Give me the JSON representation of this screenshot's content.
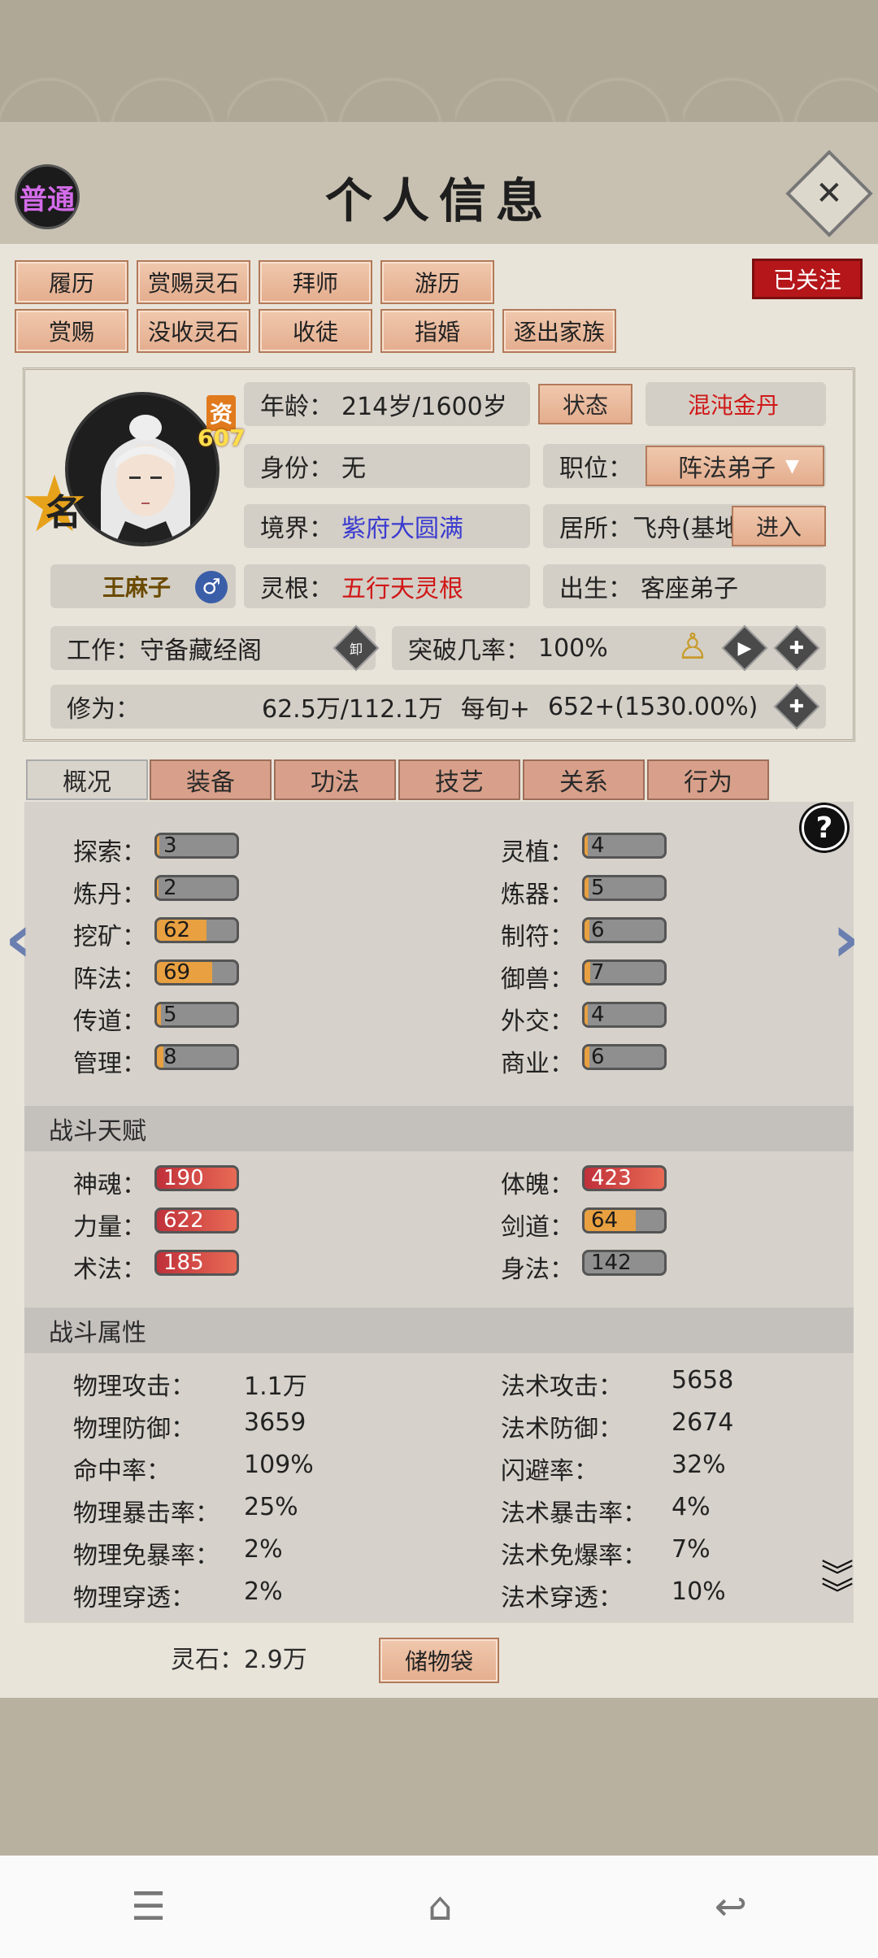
{
  "header": {
    "title": "个人信息",
    "tier": "普通",
    "follow": "已关注"
  },
  "actions": {
    "row1": [
      "履历",
      "赏赐灵石",
      "拜师",
      "游历"
    ],
    "row2": [
      "赏赐",
      "没收灵石",
      "收徒",
      "指婚",
      "逐出家族"
    ]
  },
  "character": {
    "name": "王麻子",
    "zi_label": "资",
    "zi_value": "607",
    "star_label": "名",
    "age_label": "年龄：",
    "age_value": "214岁/1600岁",
    "status_btn": "状态",
    "status_value": "混沌金丹",
    "identity_label": "身份：",
    "identity_value": "无",
    "position_label": "职位：",
    "position_value": "阵法弟子",
    "realm_label": "境界：",
    "realm_value": "紫府大圆满",
    "residence_label": "居所：",
    "residence_value": "飞舟(基地",
    "enter_btn": "进入",
    "root_label": "灵根：",
    "root_value": "五行天灵根",
    "birth_label": "出生：",
    "birth_value": "客座弟子",
    "job_label": "工作：",
    "job_value": "守备藏经阁",
    "unload_icon": "卸",
    "breakthrough_label": "突破几率：",
    "breakthrough_value": "100%",
    "cultivation_label": "修为：",
    "cultivation_value": "62.5万/112.1万",
    "per_label": "每旬+",
    "per_value": "652+(1530.00%)"
  },
  "tabs": [
    "概况",
    "装备",
    "功法",
    "技艺",
    "关系",
    "行为"
  ],
  "life_skills": {
    "left": [
      {
        "label": "探索：",
        "value": "3",
        "fill": 0.03
      },
      {
        "label": "炼丹：",
        "value": "2",
        "fill": 0.02
      },
      {
        "label": "挖矿：",
        "value": "62",
        "fill": 0.62
      },
      {
        "label": "阵法：",
        "value": "69",
        "fill": 0.69
      },
      {
        "label": "传道：",
        "value": "5",
        "fill": 0.05
      },
      {
        "label": "管理：",
        "value": "8",
        "fill": 0.08
      }
    ],
    "right": [
      {
        "label": "灵植：",
        "value": "4",
        "fill": 0.04
      },
      {
        "label": "炼器：",
        "value": "5",
        "fill": 0.05
      },
      {
        "label": "制符：",
        "value": "6",
        "fill": 0.06
      },
      {
        "label": "御兽：",
        "value": "7",
        "fill": 0.07
      },
      {
        "label": "外交：",
        "value": "4",
        "fill": 0.04
      },
      {
        "label": "商业：",
        "value": "6",
        "fill": 0.06
      }
    ]
  },
  "combat_talent": {
    "title": "战斗天赋",
    "left": [
      {
        "label": "神魂：",
        "value": "190"
      },
      {
        "label": "力量：",
        "value": "622"
      },
      {
        "label": "术法：",
        "value": "185"
      }
    ],
    "right": [
      {
        "label": "体魄：",
        "value": "423"
      },
      {
        "label": "剑道：",
        "value": "64"
      },
      {
        "label": "身法：",
        "value": "142"
      }
    ]
  },
  "combat_attrs": {
    "title": "战斗属性",
    "left": [
      {
        "label": "物理攻击：",
        "value": "1.1万"
      },
      {
        "label": "物理防御：",
        "value": "3659"
      },
      {
        "label": "命中率：",
        "value": "109%"
      },
      {
        "label": "物理暴击率：",
        "value": "25%"
      },
      {
        "label": "物理免暴率：",
        "value": "2%"
      },
      {
        "label": "物理穿透：",
        "value": "2%"
      }
    ],
    "right": [
      {
        "label": "法术攻击：",
        "value": "5658"
      },
      {
        "label": "法术防御：",
        "value": "2674"
      },
      {
        "label": "闪避率：",
        "value": "32%"
      },
      {
        "label": "法术暴击率：",
        "value": "4%"
      },
      {
        "label": "法术免爆率：",
        "value": "7%"
      },
      {
        "label": "法术穿透：",
        "value": "10%"
      }
    ]
  },
  "footer": {
    "stone_label": "灵石：",
    "stone_value": "2.9万",
    "bag": "储物袋"
  },
  "colors": {
    "accent_btn": "#e4ad8e",
    "red": "#d01818",
    "blue": "#3b3bd0",
    "orange_bar": "#e8a040",
    "red_bar": "#c0303a"
  }
}
